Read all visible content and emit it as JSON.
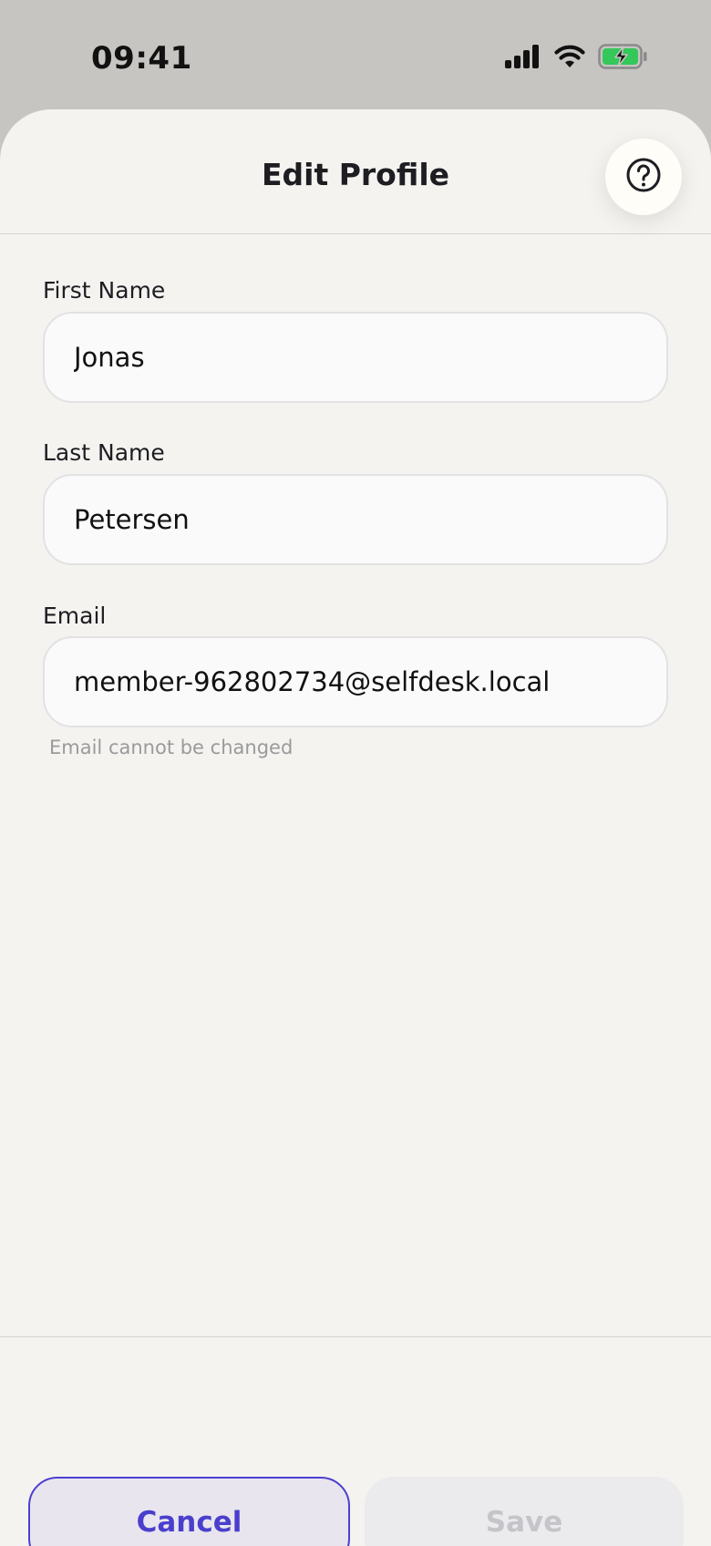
{
  "status_bar": {
    "time": "09:41",
    "icons": [
      "cellular-signal-icon",
      "wifi-icon",
      "battery-charging-icon"
    ],
    "battery_color": "#34c759"
  },
  "header": {
    "title": "Edit Profile",
    "help_icon": "question-circle-icon"
  },
  "form": {
    "first_name": {
      "label": "First Name",
      "value": "Jonas"
    },
    "last_name": {
      "label": "Last Name",
      "value": "Petersen"
    },
    "email": {
      "label": "Email",
      "value": "member-962802734@selfdesk.local",
      "helper": "Email cannot be changed"
    }
  },
  "footer": {
    "cancel_label": "Cancel",
    "save_label": "Save"
  },
  "colors": {
    "accent": "#4a3fcc",
    "sheet_background": "#f4f3f0",
    "disabled_text": "#c5c4c9"
  }
}
